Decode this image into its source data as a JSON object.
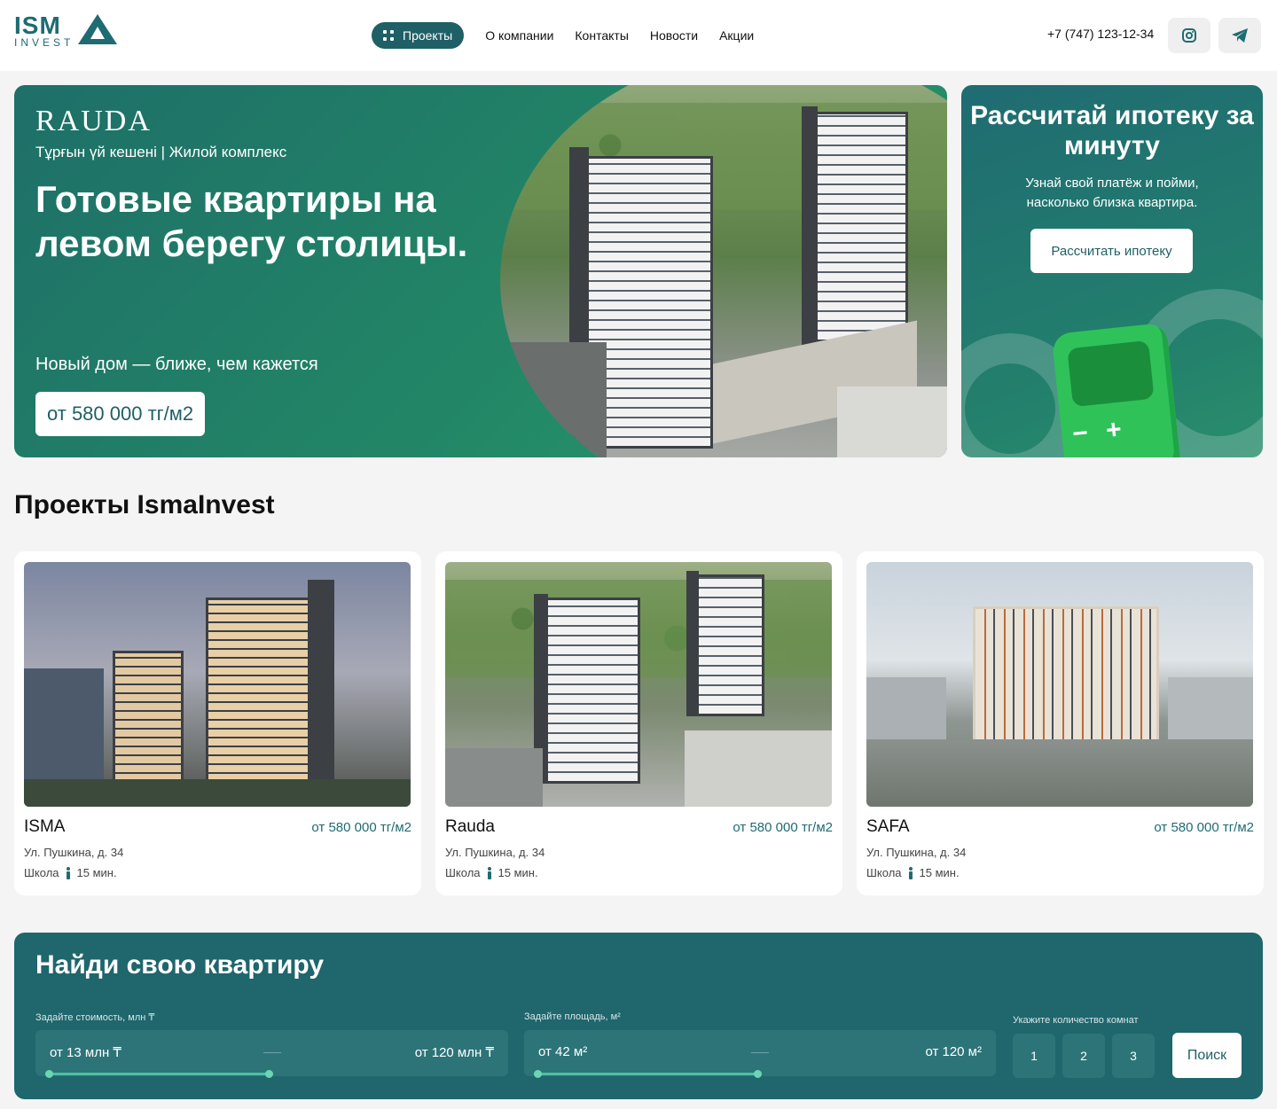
{
  "brand": {
    "logo_top": "ISM",
    "logo_bottom": "INVEST",
    "logo_color": "#1f6b72"
  },
  "nav": {
    "active": "Проекты",
    "items": [
      "О компании",
      "Контакты",
      "Новости",
      "Акции"
    ]
  },
  "contacts": {
    "phone": "+7 (747) 123-12-34",
    "social": [
      "instagram-icon",
      "telegram-icon"
    ]
  },
  "hero": {
    "brand": "RAUDA",
    "subtitle": "Тұрғын үй кешені  |  Жилой комплекс",
    "title": "Готовые квартиры на левом берегу столицы.",
    "tagline": "Новый дом — ближе, чем кажется",
    "price": "от 580 000 тг/м2"
  },
  "mortgage": {
    "title": "Рассчитай ипотеку за минуту",
    "text": "Узнай свой платёж и пойми, насколько близка квартира.",
    "button": "Рассчитать ипотеку",
    "calc_keys": [
      "−",
      "+"
    ]
  },
  "projects": {
    "title": "Проекты IsmaInvest",
    "items": [
      {
        "name": "ISMA",
        "price": "от 580 000 тг/м2",
        "address": "Ул. Пушкина, д. 34",
        "school": "Школа",
        "walk": "15 мин."
      },
      {
        "name": "Rauda",
        "price": "от 580 000 тг/м2",
        "address": "Ул. Пушкина, д. 34",
        "school": "Школа",
        "walk": "15 мин."
      },
      {
        "name": "SAFA",
        "price": "от 580 000 тг/м2",
        "address": "Ул. Пушкина, д. 34",
        "school": "Школа",
        "walk": "15 мин."
      }
    ]
  },
  "finder": {
    "title": "Найди свою квартиру",
    "price_label": "Задайте стоимость, млн ₸",
    "price_from": "от 13 млн ₸",
    "price_to": "от 120 млн ₸",
    "area_label": "Задайте площадь, м²",
    "area_from": "от 42 м²",
    "area_to": "от 120 м²",
    "rooms_label": "Укажите количество комнат",
    "rooms": [
      "1",
      "2",
      "3"
    ],
    "search": "Поиск"
  },
  "colors": {
    "primary": "#1f6b72",
    "hero_green": "#228766",
    "accent": "#4fbfa0"
  }
}
